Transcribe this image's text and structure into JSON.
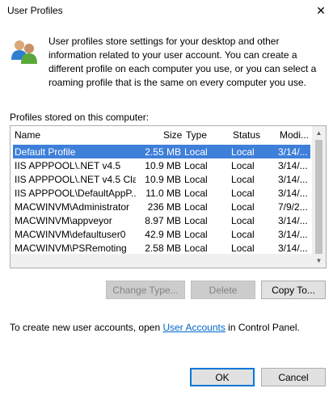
{
  "window": {
    "title": "User Profiles",
    "close_glyph": "✕"
  },
  "description": "User profiles store settings for your desktop and other information related to your user account. You can create a different profile on each computer you use, or you can select a roaming profile that is the same on every computer you use.",
  "profiles_label": "Profiles stored on this computer:",
  "table": {
    "columns": [
      "Name",
      "Size",
      "Type",
      "Status",
      "Modi..."
    ],
    "rows": [
      {
        "name": "Default Profile",
        "size": "2.55 MB",
        "type": "Local",
        "status": "Local",
        "modified": "3/14/...",
        "selected": true
      },
      {
        "name": "IIS APPPOOL\\.NET v4.5",
        "size": "10.9 MB",
        "type": "Local",
        "status": "Local",
        "modified": "3/14/..."
      },
      {
        "name": "IIS APPPOOL\\.NET v4.5 Cla...",
        "size": "10.9 MB",
        "type": "Local",
        "status": "Local",
        "modified": "3/14/..."
      },
      {
        "name": "IIS APPPOOL\\DefaultAppP...",
        "size": "11.0 MB",
        "type": "Local",
        "status": "Local",
        "modified": "3/14/..."
      },
      {
        "name": "MACWINVM\\Administrator",
        "size": "236 MB",
        "type": "Local",
        "status": "Local",
        "modified": "7/9/2..."
      },
      {
        "name": "MACWINVM\\appveyor",
        "size": "8.97 MB",
        "type": "Local",
        "status": "Local",
        "modified": "3/14/..."
      },
      {
        "name": "MACWINVM\\defaultuser0",
        "size": "42.9 MB",
        "type": "Local",
        "status": "Local",
        "modified": "3/14/..."
      },
      {
        "name": "MACWINVM\\PSRemoting",
        "size": "2.58 MB",
        "type": "Local",
        "status": "Local",
        "modified": "3/14/..."
      }
    ]
  },
  "buttons": {
    "change_type": "Change Type...",
    "delete": "Delete",
    "copy_to": "Copy To...",
    "ok": "OK",
    "cancel": "Cancel"
  },
  "footer": {
    "prefix": "To create new user accounts, open ",
    "link": "User Accounts",
    "suffix": " in Control Panel."
  },
  "colors": {
    "selection": "#3e7fd9",
    "link": "#0066cc",
    "default_button_border": "#0078d7"
  },
  "icons": {
    "info": "users-icon",
    "close": "close-icon"
  }
}
